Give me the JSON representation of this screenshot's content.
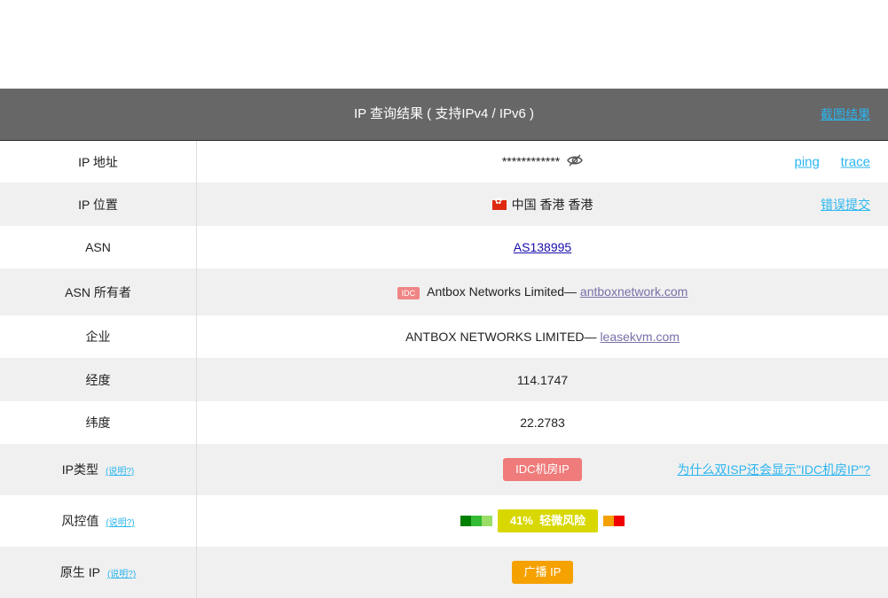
{
  "header": {
    "title": "IP 查询结果 ( 支持IPv4 / IPv6 )",
    "screenshot_link": "截图结果"
  },
  "rows": {
    "ip": {
      "label": "IP 地址",
      "value": "************",
      "link_ping": "ping",
      "link_trace": "trace"
    },
    "location": {
      "label": "IP 位置",
      "value": "中国 香港 香港",
      "report_link": "错误提交"
    },
    "asn": {
      "label": "ASN",
      "value": "AS138995"
    },
    "asn_owner": {
      "label": "ASN 所有者",
      "badge": "IDC",
      "value": "Antbox Networks Limited— ",
      "domain": "antboxnetwork.com"
    },
    "company": {
      "label": "企业",
      "value": "ANTBOX NETWORKS LIMITED— ",
      "domain": "leasekvm.com"
    },
    "longitude": {
      "label": "经度",
      "value": "114.1747"
    },
    "latitude": {
      "label": "纬度",
      "value": "22.2783"
    },
    "ip_type": {
      "label": "IP类型",
      "hint": "(说明?)",
      "value": "IDC机房IP",
      "faq": "为什么双ISP还会显示\"IDC机房IP\"?"
    },
    "risk": {
      "label": "风控值",
      "hint": "(说明?)",
      "percent": "41%",
      "level": "轻微风险"
    },
    "native": {
      "label": "原生 IP",
      "hint": "(说明?)",
      "value": "广播 IP"
    }
  },
  "colors": {
    "header_bg": "#676767",
    "link": "#2bb6f0",
    "idc_red": "#ef7b7b",
    "risk_yellow": "#d8d800",
    "native_orange": "#f5a100",
    "risk_scale": [
      "#008000",
      "#33bb33",
      "#99dd66",
      "#f5a100",
      "#ee0000"
    ]
  }
}
